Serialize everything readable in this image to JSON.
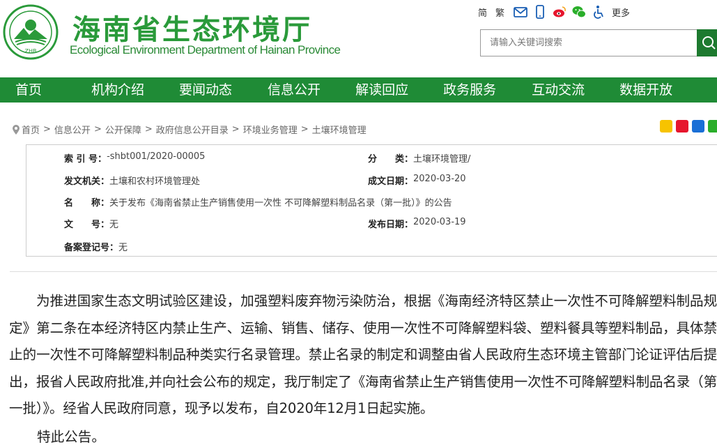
{
  "header": {
    "site_title_cn": "海南省生态环境厅",
    "site_title_en": "Ecological Environment Department of Hainan Province",
    "logo_text": "ZHB",
    "lang_simplified": "简",
    "lang_traditional": "繁",
    "more_label": "更多",
    "search_placeholder": "请输入关键词搜索",
    "brand_color": "#1f8b36"
  },
  "nav": {
    "items": [
      "首页",
      "机构介绍",
      "要闻动态",
      "信息公开",
      "解读回应",
      "政务服务",
      "互动交流",
      "数据开放"
    ]
  },
  "breadcrumb": [
    "首页",
    "信息公开",
    "公开保障",
    "政府信息公开目录",
    "环境业务管理",
    "土壤环境管理"
  ],
  "meta": {
    "index_label": "索 引 号：",
    "index_value": "-shbt001/2020-00005",
    "category_label": "分　　类：",
    "category_value": "土壤环境管理/",
    "issuer_label": "发文机关：",
    "issuer_value": "土壤和农村环境管理处",
    "created_label": "成文日期：",
    "created_value": "2020-03-20",
    "name_label": "名　　称：",
    "name_value": "关于发布《海南省禁止生产销售使用一次性 不可降解塑料制品名录（第一批）》的公告",
    "docno_label": "文　　号：",
    "docno_value": "无",
    "published_label": "发布日期：",
    "published_value": "2020-03-19",
    "record_label": "备案登记号：",
    "record_value": "无"
  },
  "article": {
    "paragraph": "为推进国家生态文明试验区建设，加强塑料废弃物污染防治，根据《海南经济特区禁止一次性不可降解塑料制品规定》第二条在本经济特区内禁止生产、运输、销售、储存、使用一次性不可降解塑料袋、塑料餐具等塑料制品，具体禁止的一次性不可降解塑料制品种类实行名录管理。禁止名录的制定和调整由省人民政府生态环境主管部门论证评估后提出，报省人民政府批准,并向社会公布的规定，我厅制定了《海南省禁止生产销售使用一次性不可降解塑料制品名录（第一批）》。经省人民政府同意，现予以发布，自2020年12月1日起实施。",
    "closing": "特此公告。"
  }
}
